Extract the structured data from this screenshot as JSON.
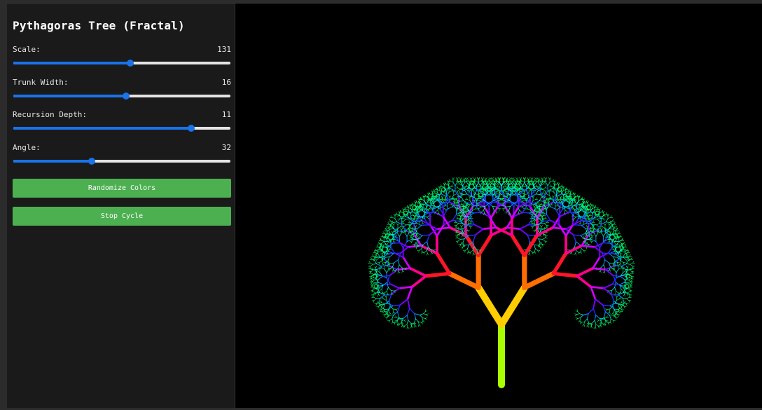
{
  "panel": {
    "title": "Pythagoras Tree (Fractal)",
    "controls": [
      {
        "key": "scale",
        "label": "Scale:",
        "value": "131",
        "fraction": 0.54
      },
      {
        "key": "trunk_width",
        "label": "Trunk Width:",
        "value": "16",
        "fraction": 0.52
      },
      {
        "key": "recursion_depth",
        "label": "Recursion Depth:",
        "value": "11",
        "fraction": 0.82
      },
      {
        "key": "angle",
        "label": "Angle:",
        "value": "32",
        "fraction": 0.36
      }
    ],
    "buttons": {
      "randomize_label": "Randomize Colors",
      "cycle_label": "Stop Cycle"
    }
  },
  "colors": {
    "panel_bg": "#1a1a1a",
    "accent": "#1a73e8",
    "button": "#4caf50",
    "canvas_bg": "#000000"
  },
  "tree": {
    "depth": 11,
    "angle_deg": 32
  }
}
